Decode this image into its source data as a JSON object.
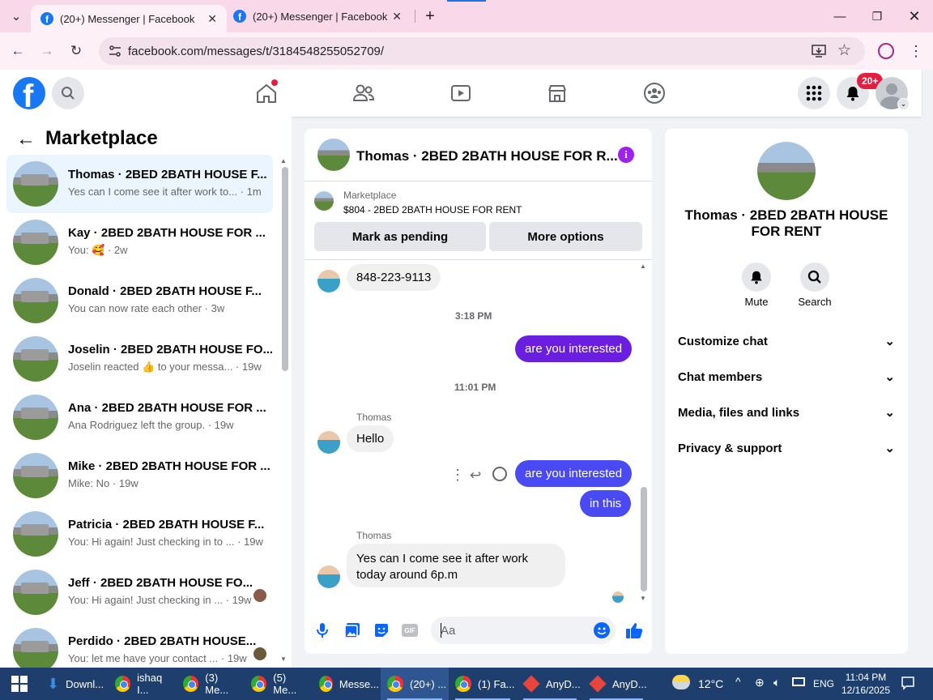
{
  "browser": {
    "tabs": [
      {
        "title": "(20+) Messenger | Facebook"
      },
      {
        "title": "(20+) Messenger | Facebook"
      }
    ],
    "url": "facebook.com/messages/t/3184548255052709/"
  },
  "header": {
    "notif_badge": "20+"
  },
  "left": {
    "title": "Marketplace",
    "conversations": [
      {
        "name": "Thomas · 2BED 2BATH HOUSE F...",
        "preview": "Yes can I come see it after work to...",
        "time": "· 1m"
      },
      {
        "name": "Kay · 2BED 2BATH HOUSE FOR ...",
        "preview": "You: 🥰",
        "time": "· 2w"
      },
      {
        "name": "Donald · 2BED 2BATH HOUSE F...",
        "preview": "You can now rate each other",
        "time": "· 3w"
      },
      {
        "name": "Joselin · 2BED 2BATH HOUSE FO...",
        "preview": "Joselin reacted 👍 to your messa...",
        "time": "· 19w"
      },
      {
        "name": "Ana · 2BED 2BATH HOUSE FOR ...",
        "preview": "Ana Rodriguez left the group.",
        "time": "· 19w"
      },
      {
        "name": "Mike · 2BED 2BATH HOUSE FOR ...",
        "preview": "Mike: No",
        "time": "· 19w"
      },
      {
        "name": "Patricia · 2BED 2BATH HOUSE F...",
        "preview": "You: Hi again! Just checking in to ...",
        "time": "· 19w"
      },
      {
        "name": "Jeff · 2BED 2BATH HOUSE FO...",
        "preview": "You: Hi again! Just checking in ...",
        "time": "· 19w"
      },
      {
        "name": "Perdido · 2BED 2BATH HOUSE...",
        "preview": "You: let me have your contact ...",
        "time": "· 19w"
      }
    ]
  },
  "chat": {
    "title": "Thomas · 2BED 2BATH HOUSE FOR R...",
    "listing_source": "Marketplace",
    "listing": "$804 - 2BED 2BATH HOUSE FOR RENT",
    "btn_pending": "Mark as pending",
    "btn_more": "More options",
    "phone": "848-223-9113",
    "time1": "3:18 PM",
    "out1": "are you interested",
    "time2": "11:01 PM",
    "sender": "Thomas",
    "hello": "Hello",
    "out2": "are you interested",
    "out3": "in this",
    "last": [
      "Yes can I come see it after work",
      "today around 6p.m"
    ],
    "input_placeholder": "Aa"
  },
  "right": {
    "name": "Thomas · 2BED 2BATH HOUSE FOR RENT",
    "mute": "Mute",
    "search": "Search",
    "sections": [
      "Customize chat",
      "Chat members",
      "Media, files and links",
      "Privacy & support"
    ]
  },
  "taskbar": {
    "items": [
      "Downl...",
      "ishaq I...",
      "(3) Me...",
      "(5) Me...",
      "Messe...",
      "(20+) ...",
      "(1) Fa...",
      "AnyD...",
      "AnyD..."
    ],
    "temp": "12°C",
    "lang": "ENG",
    "time": "11:04 PM",
    "date": "12/16/2025"
  },
  "colors": {
    "fb_blue": "#1877f2",
    "purple": "#6a1fe0",
    "blue_bubble": "#4a4af4",
    "red": "#e41e3f"
  }
}
